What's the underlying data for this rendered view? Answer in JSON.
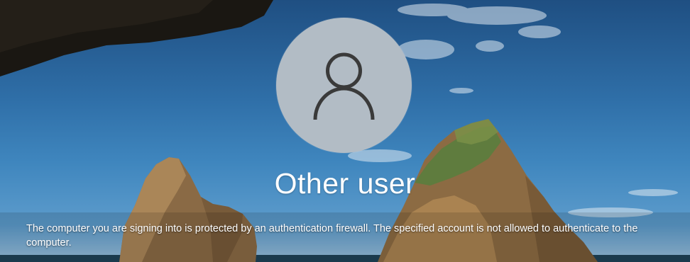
{
  "lock_screen": {
    "user_tile": {
      "icon": "user-icon",
      "name": "Other user"
    },
    "message": "The computer you are signing into is protected by an authentication firewall. The specified account is not allowed to authenticate to the computer."
  }
}
